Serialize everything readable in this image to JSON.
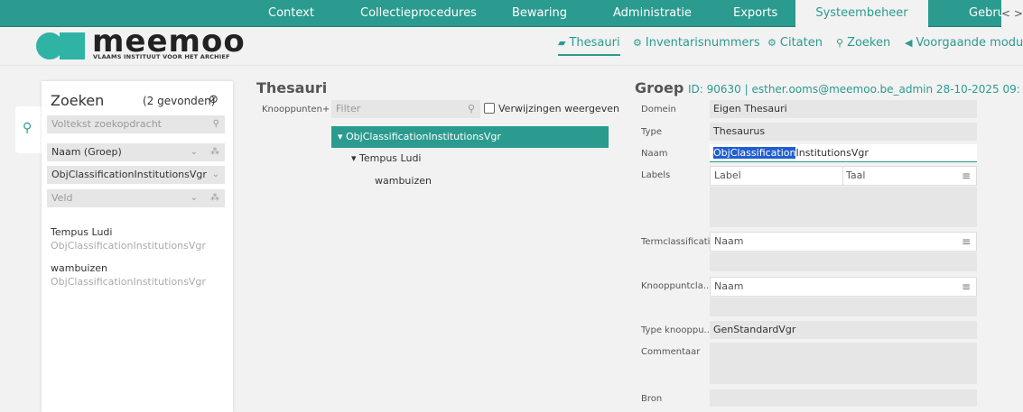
{
  "topnav": {
    "tabs": [
      "Context",
      "Collectieprocedures",
      "Bewaring",
      "Administratie",
      "Exports",
      "Systeembeheer",
      "Gebruike"
    ],
    "active": "Systeembeheer",
    "scroll_arrows": "< >"
  },
  "logo": {
    "word": "meemoo",
    "subtitle": "VLAAMS INSTITUUT VOOR HET ARCHIEF"
  },
  "subnav": [
    {
      "label": "Thesauri",
      "icon": "book-icon",
      "glyph": "▰"
    },
    {
      "label": "Inventarisnummers",
      "icon": "cogs-icon",
      "glyph": "⚙"
    },
    {
      "label": "Citaten",
      "icon": "cogs-icon",
      "glyph": "⚙"
    },
    {
      "label": "Zoeken",
      "icon": "search-icon",
      "glyph": "⚲"
    },
    {
      "label": "Voorgaande module",
      "icon": "back-circle-icon",
      "glyph": "◀"
    }
  ],
  "search": {
    "title": "Zoeken",
    "count": "(2 gevonden)",
    "fulltext_placeholder": "Voltekst zoekopdracht",
    "field1": "Naam (Groep)",
    "field2": "ObjClassificationInstitutionsVgr",
    "field3_placeholder": "Veld",
    "results": [
      {
        "title": "Tempus Ludi",
        "sub": "ObjClassificationInstitutionsVgr"
      },
      {
        "title": "wambuizen",
        "sub": "ObjClassificationInstitutionsVgr"
      }
    ]
  },
  "thesauri": {
    "title": "Thesauri",
    "nodes_label": "Knooppunten+",
    "filter_placeholder": "Filter",
    "show_refs_label": "Verwijzingen weergeven",
    "tree": [
      {
        "label": "▾ ObjClassificationInstitutionsVgr",
        "level": 0,
        "selected": true
      },
      {
        "label": "▾ Tempus Ludi",
        "level": 1
      },
      {
        "label": "wambuizen",
        "level": 2
      }
    ]
  },
  "detail": {
    "title": "Groep",
    "meta": "ID: 90630 | esther.ooms@meemoo.be_admin 28-10-2025 09:",
    "fields": {
      "domain_label": "Domein",
      "domain": "Eigen Thesauri",
      "type_label": "Type",
      "type": "Thesaurus",
      "name_label": "Naam",
      "name_highlight": "ObjClassification",
      "name_rest": "InstitutionsVgr",
      "labels_label": "Labels",
      "labels_col1": "Label",
      "labels_col2": "Taal",
      "termclass_label": "Termclassificatie",
      "termclass_col": "Naam",
      "nodeclass_label": "Knooppuntcla...",
      "nodeclass_col": "Naam",
      "nodetype_label": "Type knooppu...",
      "nodetype": "GenStandardVgr",
      "comment_label": "Commentaar",
      "source_label": "Bron"
    }
  },
  "colors": {
    "accent": "#2b9b8f",
    "field_bg": "#e6e6e6",
    "highlight": "#1f5fcf"
  }
}
